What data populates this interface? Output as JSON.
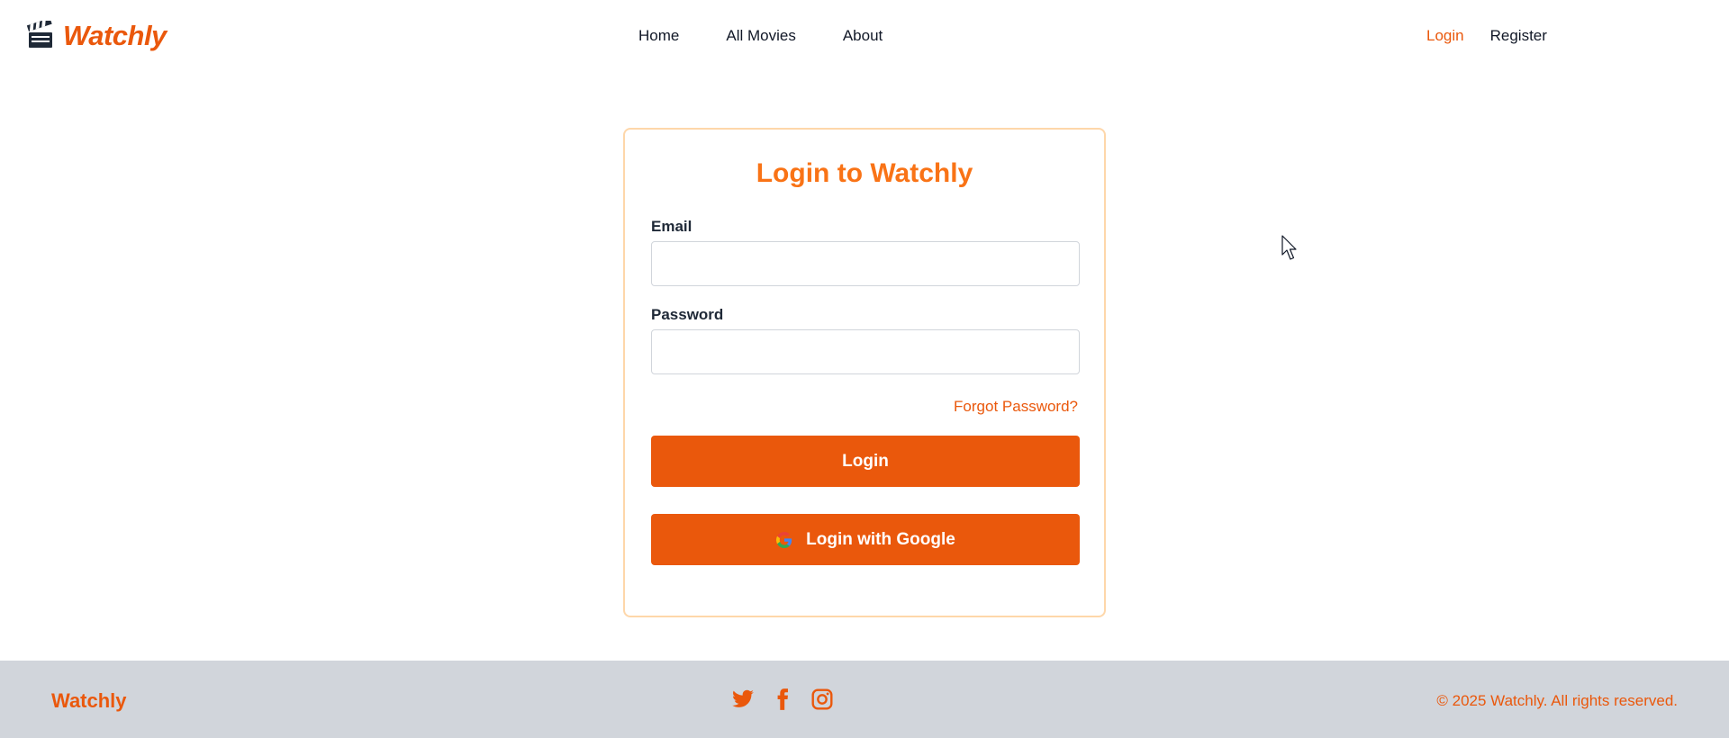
{
  "brand": {
    "name": "Watchly"
  },
  "nav": {
    "center": [
      {
        "label": "Home"
      },
      {
        "label": "All Movies"
      },
      {
        "label": "About"
      }
    ],
    "right": [
      {
        "label": "Login",
        "active": true
      },
      {
        "label": "Register",
        "active": false
      }
    ]
  },
  "login_form": {
    "title": "Login to Watchly",
    "email_label": "Email",
    "email_value": "",
    "password_label": "Password",
    "password_value": "",
    "forgot_password": "Forgot Password?",
    "login_button": "Login",
    "google_button": "Login with Google"
  },
  "footer": {
    "brand": "Watchly",
    "socials": [
      "twitter-icon",
      "facebook-icon",
      "instagram-icon"
    ],
    "copyright": "© 2025 Watchly. All rights reserved."
  },
  "colors": {
    "accent": "#ea580c",
    "title": "#f97316",
    "card_border": "#fed7aa",
    "footer_bg": "#d1d5db"
  }
}
